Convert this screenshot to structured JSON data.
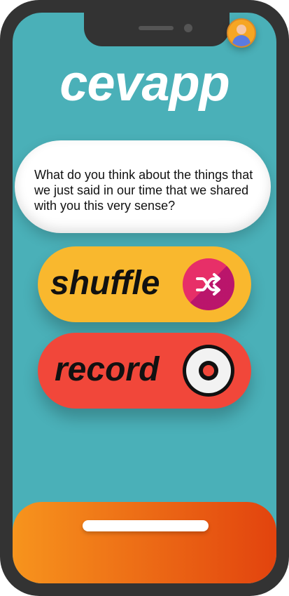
{
  "app": {
    "title": "cevapp"
  },
  "question": {
    "text": "What do you think about the things that we just said in our time that we shared with you this very sense?"
  },
  "actions": {
    "shuffle_label": "shuffle",
    "record_label": "record"
  },
  "icons": {
    "avatar": "user-avatar-icon",
    "shuffle": "shuffle-icon",
    "record": "record-icon"
  },
  "colors": {
    "screen_bg": "#4ab0b8",
    "shuffle_button": "#f9b82e",
    "shuffle_icon": "#e72f68",
    "record_button": "#f1473a",
    "footer_gradient_start": "#f7941d",
    "footer_gradient_end": "#e2430e"
  }
}
